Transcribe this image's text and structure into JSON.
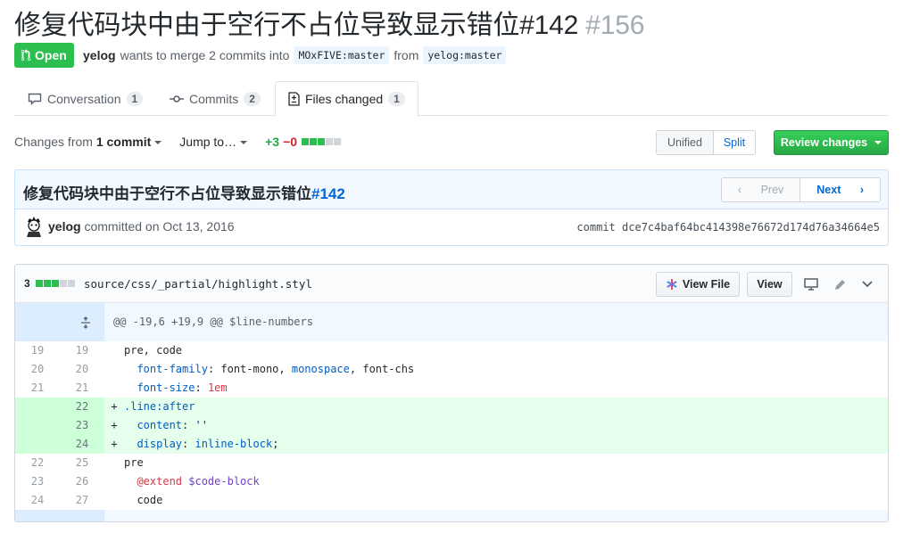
{
  "pr": {
    "title": "修复代码块中由于空行不占位导致显示错位#142",
    "number": "#156",
    "state": "Open",
    "author": "yelog",
    "merge_text": "wants to merge 2 commits into",
    "base_ref": "MOxFIVE:master",
    "from_text": "from",
    "head_ref": "yelog:master"
  },
  "tabs": [
    {
      "label": "Conversation",
      "count": "1",
      "icon": "comment-icon"
    },
    {
      "label": "Commits",
      "count": "2",
      "icon": "commit-icon"
    },
    {
      "label": "Files changed",
      "count": "1",
      "icon": "file-diff-icon"
    }
  ],
  "toolbar": {
    "changes_prefix": "Changes from",
    "changes_value": "1 commit",
    "jump_to": "Jump to…",
    "additions": "+3",
    "deletions": "−0",
    "unified": "Unified",
    "split": "Split",
    "review": "Review changes"
  },
  "commit": {
    "title_text": "修复代码块中由于空行不占位导致显示错位",
    "title_link": "#142",
    "prev": "Prev",
    "next": "Next",
    "author": "yelog",
    "committed_text": "committed on Oct 13, 2016",
    "sha_label": "commit",
    "sha": "dce7c4baf64bc414398e76672d174d76a34664e5"
  },
  "file": {
    "change_count": "3",
    "path": "source/css/_partial/highlight.styl",
    "view_file": "View File",
    "view": "View",
    "hunk_header": "@@ -19,6 +19,9 @@ $line-numbers",
    "lines": [
      {
        "type": "ctx",
        "old": "19",
        "new": "19",
        "marker": " "
      },
      {
        "type": "ctx",
        "old": "20",
        "new": "20",
        "marker": " "
      },
      {
        "type": "ctx",
        "old": "21",
        "new": "21",
        "marker": " "
      },
      {
        "type": "add",
        "old": "",
        "new": "22",
        "marker": "+"
      },
      {
        "type": "add",
        "old": "",
        "new": "23",
        "marker": "+"
      },
      {
        "type": "add",
        "old": "",
        "new": "24",
        "marker": "+"
      },
      {
        "type": "ctx",
        "old": "22",
        "new": "25",
        "marker": " "
      },
      {
        "type": "ctx",
        "old": "23",
        "new": "26",
        "marker": " "
      },
      {
        "type": "ctx",
        "old": "24",
        "new": "27",
        "marker": " "
      }
    ],
    "code": {
      "l19": "pre, code",
      "l20_prop": "font-family",
      "l20_rest1": ": font-mono, ",
      "l20_kw": "monospace",
      "l20_rest2": ", font-chs",
      "l21_prop": "font-size",
      "l21_colon": ": ",
      "l21_num": "1em",
      "l22": ".line:after",
      "l23_prop": "content",
      "l23_colon": ": ",
      "l23_str": "''",
      "l24_prop": "display",
      "l24_colon": ": ",
      "l24_kw": "inline-block",
      "l24_end": ";",
      "l25": "pre",
      "l26_at": "@extend",
      "l26_var": " $code-block",
      "l27": "code"
    }
  },
  "colors": {
    "open_green": "#2cbe4e",
    "link_blue": "#0366d6",
    "addition_bg": "#e6ffed",
    "hunk_bg": "#f1f8ff"
  }
}
